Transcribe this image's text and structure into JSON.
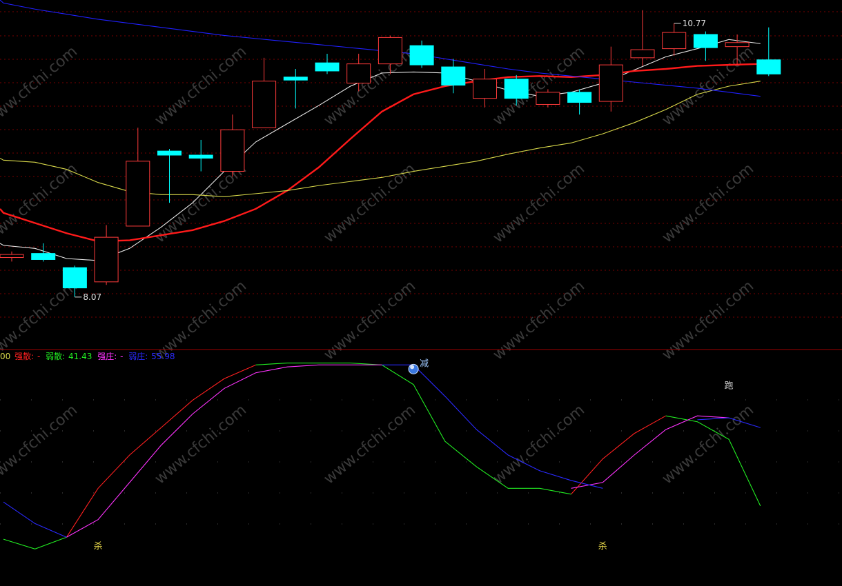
{
  "colors": {
    "background": "#000000",
    "up_candle": "#ff3b3b",
    "down_candle": "#00ffff",
    "ma_white": "#e8e8e8",
    "ma_red": "#ff1a1a",
    "ma_yellow": "#d8d84a",
    "ma_blue": "#2020ff",
    "grid": "#7a0000",
    "divider": "#a00000",
    "strong_disperse": "#ff2020",
    "weak_disperse": "#22ee22",
    "strong_control": "#ff33ff",
    "weak_control": "#2a2aff",
    "signal": "#e8d84a",
    "label_text": "#e0e0e0"
  },
  "watermark": "www.cfchi.com",
  "indicator_header": {
    "prefix": "00",
    "items": [
      {
        "label": "强散:",
        "value": "-",
        "color": "#ff2020"
      },
      {
        "label": "弱散:",
        "value": "41.43",
        "color": "#22ee22"
      },
      {
        "label": "强庄:",
        "value": "-",
        "color": "#ff33ff"
      },
      {
        "label": "弱庄:",
        "value": "55.98",
        "color": "#2a2aff"
      }
    ]
  },
  "chart_data": [
    {
      "type": "candlestick",
      "ylim": [
        7.6,
        11.0
      ],
      "annotations": [
        {
          "text": "10.77",
          "value": 10.77,
          "index": 21
        },
        {
          "text": "8.07",
          "value": 8.07,
          "index": 2
        }
      ],
      "candles": [
        {
          "o": 8.46,
          "c": 8.49,
          "h": 8.52,
          "l": 8.42
        },
        {
          "o": 8.5,
          "c": 8.44,
          "h": 8.6,
          "l": 8.42
        },
        {
          "o": 8.36,
          "c": 8.16,
          "h": 8.38,
          "l": 8.07
        },
        {
          "o": 8.22,
          "c": 8.66,
          "h": 8.78,
          "l": 8.19
        },
        {
          "o": 8.77,
          "c": 9.41,
          "h": 9.74,
          "l": 8.77
        },
        {
          "o": 9.51,
          "c": 9.47,
          "h": 9.53,
          "l": 9.0
        },
        {
          "o": 9.47,
          "c": 9.44,
          "h": 9.62,
          "l": 9.31
        },
        {
          "o": 9.31,
          "c": 9.72,
          "h": 9.87,
          "l": 9.26
        },
        {
          "o": 9.74,
          "c": 10.2,
          "h": 10.43,
          "l": 9.74
        },
        {
          "o": 10.24,
          "c": 10.21,
          "h": 10.32,
          "l": 9.93
        },
        {
          "o": 10.38,
          "c": 10.3,
          "h": 10.47,
          "l": 10.27
        },
        {
          "o": 10.18,
          "c": 10.37,
          "h": 10.47,
          "l": 10.1
        },
        {
          "o": 10.37,
          "c": 10.63,
          "h": 10.65,
          "l": 10.27
        },
        {
          "o": 10.55,
          "c": 10.36,
          "h": 10.6,
          "l": 10.33
        },
        {
          "o": 10.34,
          "c": 10.16,
          "h": 10.42,
          "l": 10.08
        },
        {
          "o": 10.03,
          "c": 10.22,
          "h": 10.32,
          "l": 9.94
        },
        {
          "o": 10.22,
          "c": 10.03,
          "h": 10.26,
          "l": 9.96
        },
        {
          "o": 9.97,
          "c": 10.09,
          "h": 10.12,
          "l": 9.94
        },
        {
          "o": 10.09,
          "c": 9.99,
          "h": 10.12,
          "l": 9.87
        },
        {
          "o": 10.0,
          "c": 10.36,
          "h": 10.54,
          "l": 9.9
        },
        {
          "o": 10.43,
          "c": 10.51,
          "h": 10.9,
          "l": 10.35
        },
        {
          "o": 10.52,
          "c": 10.68,
          "h": 10.77,
          "l": 10.45
        },
        {
          "o": 10.66,
          "c": 10.53,
          "h": 10.69,
          "l": 10.4
        },
        {
          "o": 10.54,
          "c": 10.58,
          "h": 10.66,
          "l": 10.36
        },
        {
          "o": 10.41,
          "c": 10.27,
          "h": 10.73,
          "l": 10.25
        }
      ],
      "series": [
        {
          "values": [
            8.58,
            8.55,
            8.45,
            8.43,
            8.55,
            8.76,
            9.0,
            9.31,
            9.6,
            9.78,
            9.96,
            10.15,
            10.28,
            10.29,
            10.28,
            10.2,
            10.11,
            10.05,
            10.09,
            10.18,
            10.31,
            10.44,
            10.52,
            10.61,
            10.57
          ],
          "color_key": "ma_white"
        },
        {
          "values": [
            8.9,
            8.8,
            8.7,
            8.62,
            8.63,
            8.68,
            8.73,
            8.82,
            8.94,
            9.12,
            9.35,
            9.63,
            9.9,
            10.07,
            10.15,
            10.2,
            10.24,
            10.25,
            10.24,
            10.26,
            10.3,
            10.32,
            10.35,
            10.36,
            10.37
          ],
          "color_key": "ma_red"
        },
        {
          "values": [
            9.42,
            9.4,
            9.33,
            9.2,
            9.11,
            9.08,
            9.08,
            9.06,
            9.09,
            9.12,
            9.17,
            9.21,
            9.25,
            9.31,
            9.36,
            9.41,
            9.48,
            9.54,
            9.59,
            9.68,
            9.79,
            9.92,
            10.07,
            10.15,
            10.2
          ],
          "color_key": "ma_yellow"
        },
        {
          "values": [
            10.97,
            10.91,
            10.86,
            10.81,
            10.77,
            10.73,
            10.69,
            10.65,
            10.62,
            10.59,
            10.56,
            10.53,
            10.5,
            10.47,
            10.42,
            10.37,
            10.32,
            10.28,
            10.25,
            10.22,
            10.19,
            10.16,
            10.13,
            10.09,
            10.05
          ],
          "color_key": "ma_blue"
        }
      ]
    },
    {
      "type": "line",
      "ylim": [
        0,
        100
      ],
      "x_index_range": [
        0,
        24
      ],
      "series": [
        {
          "name": "强散",
          "color_key": "strong_disperse",
          "segments": [
            [
              [
                2,
                8
              ],
              [
                3,
                33
              ],
              [
                4,
                50
              ],
              [
                5,
                64
              ],
              [
                6,
                78
              ],
              [
                7,
                89
              ],
              [
                8,
                96
              ]
            ],
            [
              [
                18,
                30
              ],
              [
                19,
                48
              ],
              [
                20,
                61
              ],
              [
                21,
                70
              ]
            ]
          ]
        },
        {
          "name": "弱散",
          "color_key": "weak_disperse",
          "segments": [
            [
              [
                0,
                7
              ],
              [
                1,
                2
              ],
              [
                2,
                8
              ]
            ],
            [
              [
                8,
                96
              ],
              [
                9,
                97
              ],
              [
                10,
                97
              ],
              [
                11,
                97
              ],
              [
                12,
                96
              ],
              [
                13,
                86
              ],
              [
                14,
                57
              ],
              [
                15,
                44
              ],
              [
                16,
                33
              ],
              [
                17,
                33
              ],
              [
                18,
                30
              ]
            ],
            [
              [
                21,
                70
              ],
              [
                22,
                67
              ],
              [
                23,
                58
              ],
              [
                24,
                24
              ]
            ]
          ]
        },
        {
          "name": "强庄",
          "color_key": "strong_control",
          "segments": [
            [
              [
                2,
                8
              ],
              [
                3,
                17
              ],
              [
                4,
                36
              ],
              [
                5,
                55
              ],
              [
                6,
                71
              ],
              [
                7,
                84
              ],
              [
                8,
                92
              ],
              [
                9,
                95
              ],
              [
                10,
                96
              ],
              [
                11,
                96
              ],
              [
                12,
                96
              ]
            ],
            [
              [
                18,
                33
              ],
              [
                19,
                36
              ],
              [
                20,
                50
              ],
              [
                21,
                63
              ],
              [
                22,
                70
              ],
              [
                23,
                69
              ]
            ]
          ]
        },
        {
          "name": "弱庄",
          "color_key": "weak_control",
          "segments": [
            [
              [
                0,
                26
              ],
              [
                1,
                15
              ],
              [
                2,
                8
              ]
            ],
            [
              [
                12,
                96
              ],
              [
                13,
                96
              ],
              [
                14,
                80
              ],
              [
                15,
                63
              ],
              [
                16,
                50
              ],
              [
                17,
                42
              ],
              [
                18,
                37
              ],
              [
                19,
                33
              ]
            ],
            [
              [
                22,
                68
              ],
              [
                23,
                69
              ],
              [
                24,
                64
              ]
            ]
          ]
        }
      ],
      "signals": [
        {
          "text": "杀",
          "index": 3,
          "value": 2
        },
        {
          "text": "杀",
          "index": 19,
          "value": 2
        },
        {
          "text": "减",
          "index": 13,
          "value": 96,
          "marker": true
        },
        {
          "text": "跑",
          "index": 23,
          "value": 84
        }
      ]
    }
  ]
}
